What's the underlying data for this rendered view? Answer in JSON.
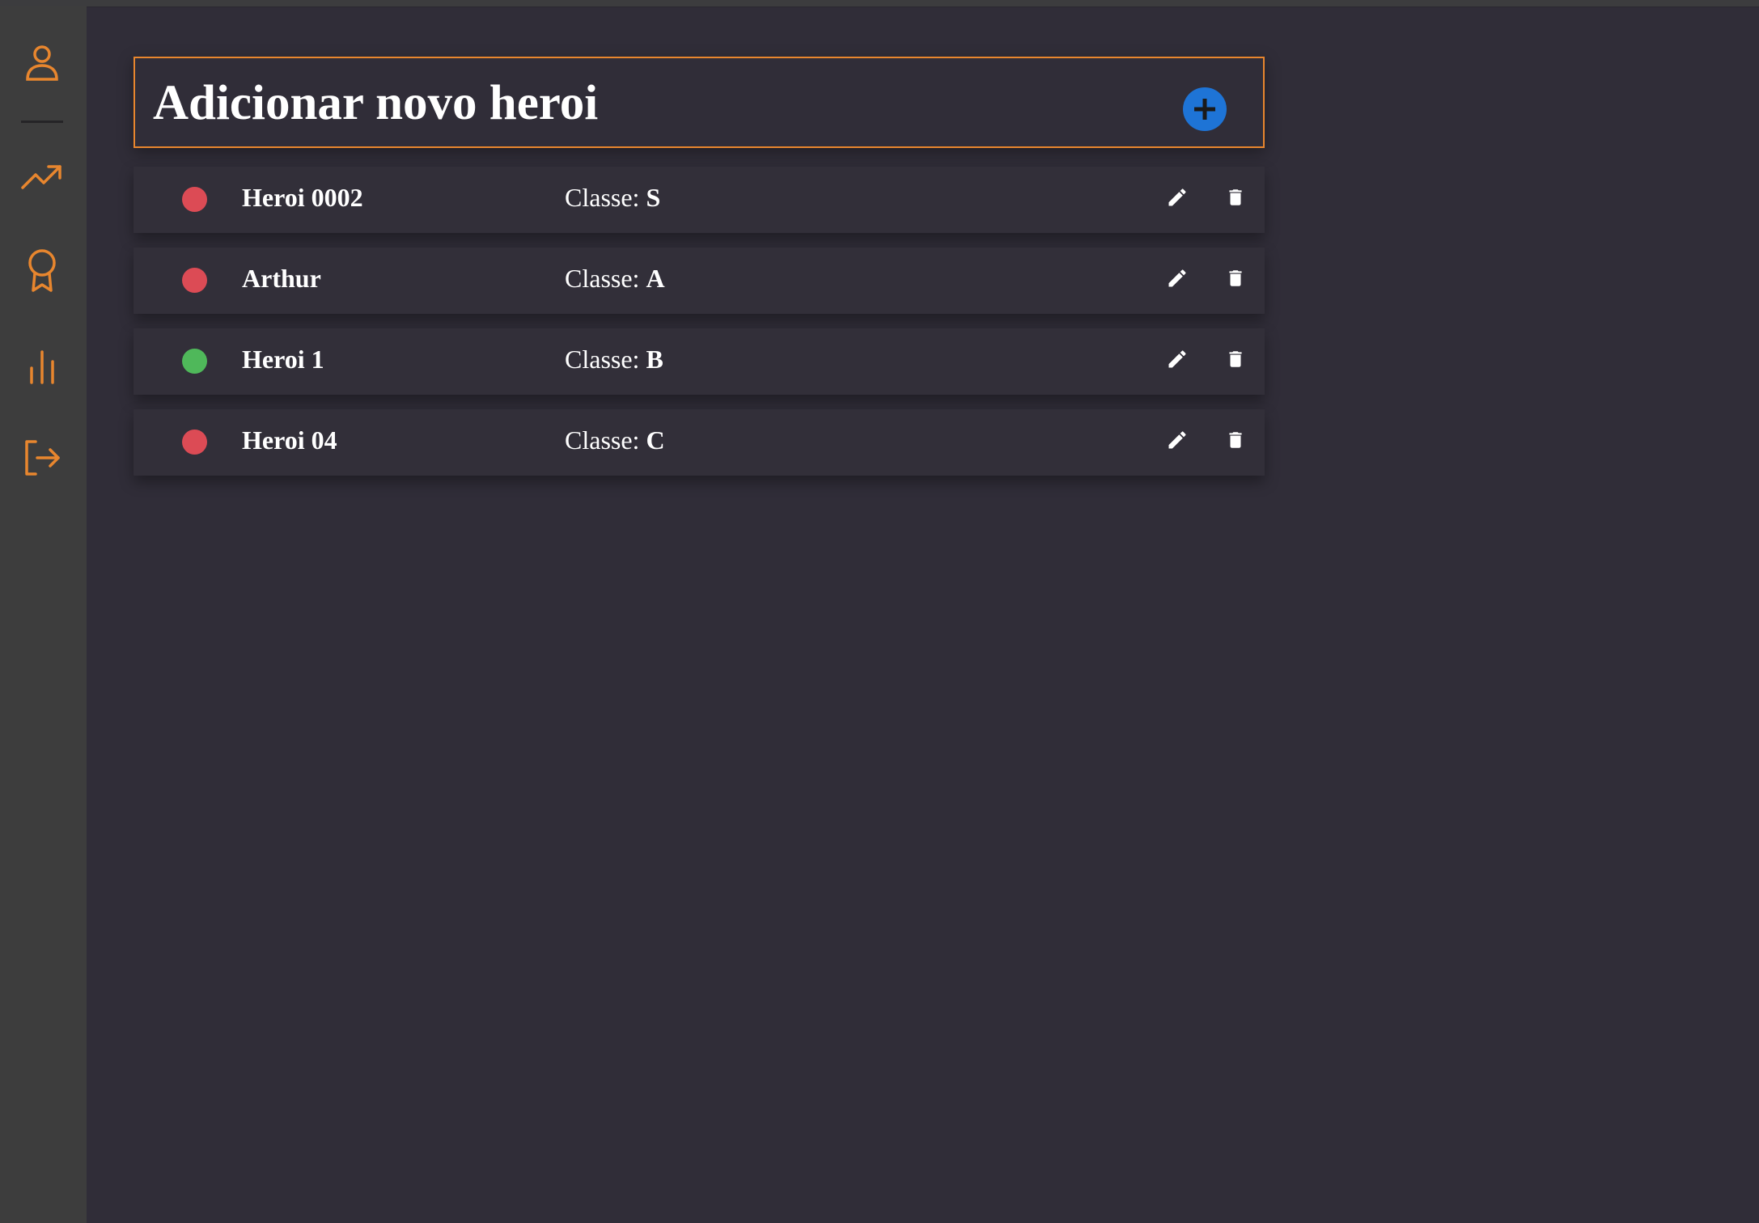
{
  "colors": {
    "accent": "#e8862e",
    "background": "#302d38",
    "sidebar": "#3d3d3d",
    "add_button": "#1e74d6",
    "status_inactive": "#dc4b55",
    "status_active": "#4fb85a",
    "text": "#ffffff"
  },
  "sidebar": {
    "items": [
      {
        "icon": "user-icon"
      },
      {
        "icon": "trending-up-icon"
      },
      {
        "icon": "award-icon"
      },
      {
        "icon": "bar-chart-icon"
      },
      {
        "icon": "logout-icon"
      }
    ]
  },
  "add_section": {
    "title": "Adicionar novo heroi",
    "button_icon": "plus-icon"
  },
  "heroes": [
    {
      "name": "Heroi 0002",
      "class_label": "Classe:",
      "class_value": "S",
      "status": "inactive"
    },
    {
      "name": "Arthur",
      "class_label": "Classe:",
      "class_value": "A",
      "status": "inactive"
    },
    {
      "name": "Heroi 1",
      "class_label": "Classe:",
      "class_value": "B",
      "status": "active"
    },
    {
      "name": "Heroi 04",
      "class_label": "Classe:",
      "class_value": "C",
      "status": "inactive"
    }
  ]
}
